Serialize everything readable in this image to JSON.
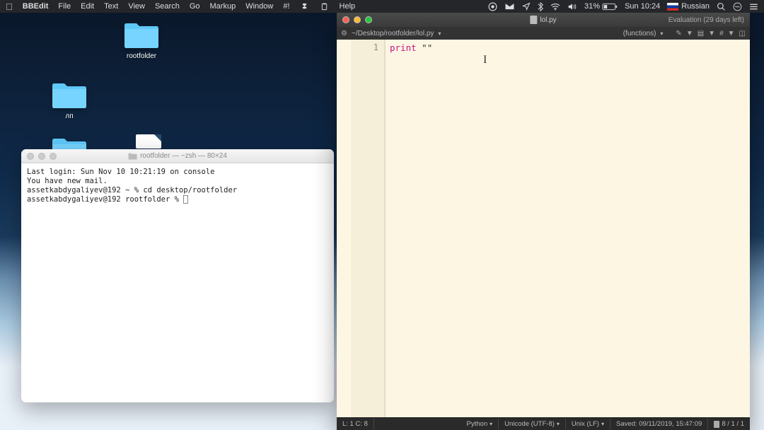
{
  "menubar": {
    "app_name": "BBEdit",
    "items": [
      "File",
      "Edit",
      "Text",
      "View",
      "Search",
      "Go",
      "Markup",
      "Window",
      "#!"
    ],
    "right": {
      "icons": [
        "obs-icon",
        "mail-icon",
        "wifi-icon",
        "bluetooth-icon",
        "volume-icon"
      ],
      "battery": "31%",
      "clock": "Sun 10:24",
      "input": "Russian",
      "help": "Help"
    }
  },
  "desktop": {
    "folders": [
      {
        "label": "rootfolder"
      },
      {
        "label": "лп"
      }
    ]
  },
  "terminal": {
    "title": "rootfolder — ~zsh — 80×24",
    "lines": [
      "Last login: Sun Nov 10 10:21:19 on console",
      "You have new mail.",
      "assetkabdygaliyev@192 ~ % cd desktop/rootfolder",
      "assetkabdygaliyev@192 rootfolder % "
    ]
  },
  "editor": {
    "filename": "lol.py",
    "evaluation": "Evaluation (29 days left)",
    "path": "~/Desktop/rootfolder/lol.py",
    "functions_label": "(functions)",
    "line_number": "1",
    "code_keyword": "print",
    "code_rest": " \"\"",
    "status": {
      "pos": "L: 1 C: 8",
      "lang": "Python",
      "encoding": "Unicode (UTF-8)",
      "lineend": "Unix (LF)",
      "saved": "Saved: 09/11/2019, 15:47:09",
      "counts": "8 / 1 / 1"
    }
  }
}
